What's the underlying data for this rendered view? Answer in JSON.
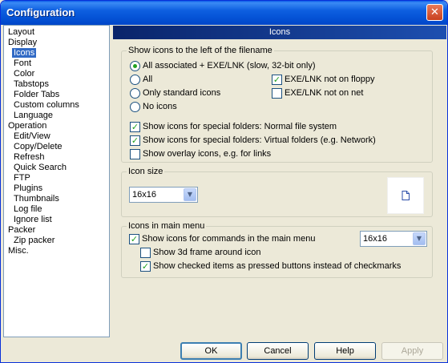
{
  "window": {
    "title": "Configuration",
    "close_glyph": "✕"
  },
  "sidebar": {
    "items": [
      {
        "label": "Layout",
        "level": 0
      },
      {
        "label": "Display",
        "level": 0
      },
      {
        "label": "Icons",
        "level": 1,
        "selected": true
      },
      {
        "label": "Font",
        "level": 1
      },
      {
        "label": "Color",
        "level": 1
      },
      {
        "label": "Tabstops",
        "level": 1
      },
      {
        "label": "Folder Tabs",
        "level": 1
      },
      {
        "label": "Custom columns",
        "level": 1
      },
      {
        "label": "Language",
        "level": 1
      },
      {
        "label": "Operation",
        "level": 0
      },
      {
        "label": "Edit/View",
        "level": 1
      },
      {
        "label": "Copy/Delete",
        "level": 1
      },
      {
        "label": "Refresh",
        "level": 1
      },
      {
        "label": "Quick Search",
        "level": 1
      },
      {
        "label": "FTP",
        "level": 1
      },
      {
        "label": "Plugins",
        "level": 1
      },
      {
        "label": "Thumbnails",
        "level": 1
      },
      {
        "label": "Log file",
        "level": 1
      },
      {
        "label": "Ignore list",
        "level": 1
      },
      {
        "label": "Packer",
        "level": 0
      },
      {
        "label": "Zip packer",
        "level": 1
      },
      {
        "label": "Misc.",
        "level": 0
      }
    ]
  },
  "panel": {
    "header": "Icons",
    "group_show": {
      "title": "Show icons to the left of the filename",
      "radio_all_associated": "All associated + EXE/LNK (slow, 32-bit only)",
      "radio_all": "All",
      "radio_standard": "Only standard icons",
      "radio_none": "No icons",
      "selected_radio": "All associated + EXE/LNK (slow, 32-bit only)",
      "check_floppy": "EXE/LNK not on floppy",
      "check_floppy_checked": true,
      "check_net": "EXE/LNK not on net",
      "check_net_checked": false,
      "check_special_fs": "Show icons for special folders: Normal file system",
      "check_special_fs_checked": true,
      "check_special_virtual": "Show icons for special folders: Virtual folders (e.g. Network)",
      "check_special_virtual_checked": true,
      "check_overlay": "Show overlay icons, e.g. for links",
      "check_overlay_checked": false
    },
    "group_size": {
      "title": "Icon size",
      "value": "16x16"
    },
    "group_menu": {
      "title": "Icons in main menu",
      "check_commands": "Show icons for commands in the main menu",
      "check_commands_checked": true,
      "menu_size": "16x16",
      "check_3d": "Show 3d frame around icon",
      "check_3d_checked": false,
      "check_pressed": "Show checked items as pressed buttons instead of checkmarks",
      "check_pressed_checked": true
    }
  },
  "buttons": {
    "ok": "OK",
    "cancel": "Cancel",
    "help": "Help",
    "apply": "Apply"
  },
  "glyphs": {
    "check": "✓",
    "dropdown": "▼"
  }
}
